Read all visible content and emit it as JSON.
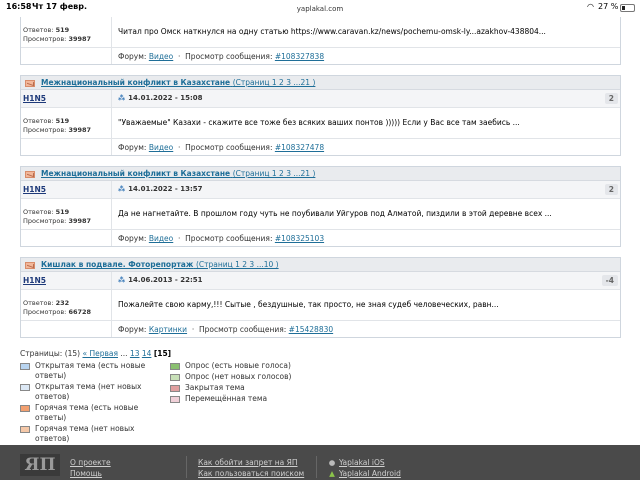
{
  "status_bar": {
    "time": "16:58",
    "date": "Чт 17 февр.",
    "url": "yaplakal.com",
    "battery": "27 %"
  },
  "posts": [
    {
      "partial": true,
      "date": "",
      "answers_label": "Ответов:",
      "answers": "519",
      "views_label": "Просмотров:",
      "views": "39987",
      "message": "Читал про Омск наткнулся на одну статью https://www.caravan.kz/news/pochemu-omsk-ly...azakhov-438804...",
      "forum_label": "Форум:",
      "forum": "Видео",
      "view_label": "Просмотр сообщения:",
      "msg_id": "#108327838"
    },
    {
      "topic": "Межнациональный конфликт в Казахстане",
      "pages": "(Страниц 1 2 3 ...21 )",
      "author": "H1N5",
      "date": "14.01.2022 - 15:08",
      "score": "2",
      "answers_label": "Ответов:",
      "answers": "519",
      "views_label": "Просмотров:",
      "views": "39987",
      "message": "\"Уважаемые\" Казахи - скажите все тоже без всяких ваших понтов ))))) Если у Вас все там заебись ...",
      "forum_label": "Форум:",
      "forum": "Видео",
      "view_label": "Просмотр сообщения:",
      "msg_id": "#108327478"
    },
    {
      "topic": "Межнациональный конфликт в Казахстане",
      "pages": "(Страниц 1 2 3 ...21 )",
      "author": "H1N5",
      "date": "14.01.2022 - 13:57",
      "score": "2",
      "answers_label": "Ответов:",
      "answers": "519",
      "views_label": "Просмотров:",
      "views": "39987",
      "message": "Да не нагнетайте. В прошлом году чуть не поубивали Уйгуров под Алматой, пиздили в этой деревне всех ...",
      "forum_label": "Форум:",
      "forum": "Видео",
      "view_label": "Просмотр сообщения:",
      "msg_id": "#108325103"
    },
    {
      "topic": "Кишлак в подвале. Фоторепортаж",
      "pages": "(Страниц 1 2 3 ...10 )",
      "author": "H1N5",
      "date": "14.06.2013 - 22:51",
      "score": "-4",
      "answers_label": "Ответов:",
      "answers": "232",
      "views_label": "Просмотров:",
      "views": "66728",
      "message": "Пожалейте свою карму,!!! Сытые , бездушные, так просто, не зная судеб человеческих, равн...",
      "forum_label": "Форум:",
      "forum": "Картинки",
      "view_label": "Просмотр сообщения:",
      "msg_id": "#15428830"
    }
  ],
  "pager": {
    "label": "Страницы:",
    "count": "(15)",
    "first": "« Первая",
    "dots": "...",
    "p13": "13",
    "p14": "14",
    "current": "[15]"
  },
  "legend": {
    "col1": [
      {
        "label": "Открытая тема (есть новые ответы)",
        "icon": "envelope-new-icon",
        "color": "#b8d4f0"
      },
      {
        "label": "Открытая тема (нет новых ответов)",
        "icon": "envelope-icon",
        "color": "#dce8f5"
      },
      {
        "label": "Горячая тема (есть новые ответы)",
        "icon": "hot-envelope-new-icon",
        "color": "#f2a070"
      },
      {
        "label": "Горячая тема (нет новых ответов)",
        "icon": "hot-envelope-icon",
        "color": "#f5c8a8"
      }
    ],
    "col2": [
      {
        "label": "Опрос (есть новые голоса)",
        "icon": "poll-new-icon",
        "color": "#8ac070"
      },
      {
        "label": "Опрос (нет новых голосов)",
        "icon": "poll-icon",
        "color": "#c8e0b8"
      },
      {
        "label": "Закрытая тема",
        "icon": "lock-icon",
        "color": "#e0a0a0"
      },
      {
        "label": "Перемещённая тема",
        "icon": "moved-icon",
        "color": "#f0d0d8"
      }
    ]
  },
  "footer": {
    "logo": "ЯП",
    "col1": [
      "О проекте",
      "Помощь"
    ],
    "col2": [
      "Как обойти запрет на ЯП",
      "Как пользоваться поиском"
    ],
    "col3": [
      "Yaplakal iOS",
      "Yaplakal Android"
    ]
  }
}
